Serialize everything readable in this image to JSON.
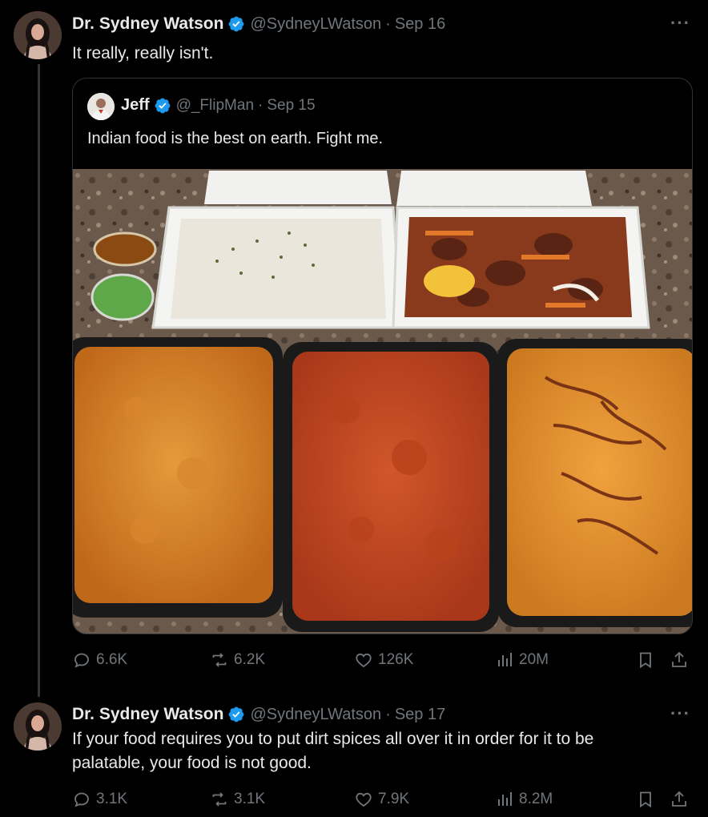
{
  "thread": [
    {
      "author": {
        "name": "Dr. Sydney Watson",
        "handle": "@SydneyLWatson",
        "date": "Sep 16",
        "avatar_icon": "profile-photo"
      },
      "text": "It really, really isn't.",
      "more_label": "···",
      "quoted": {
        "author": {
          "name": "Jeff",
          "handle": "@_FlipMan",
          "date": "Sep 15"
        },
        "text": "Indian food is the best on earth. Fight me.",
        "image_description": "Indian takeout: rice, chicken, three curries"
      },
      "stats": {
        "replies": "6.6K",
        "reposts": "6.2K",
        "likes": "126K",
        "views": "20M"
      }
    },
    {
      "author": {
        "name": "Dr. Sydney Watson",
        "handle": "@SydneyLWatson",
        "date": "Sep 17",
        "avatar_icon": "profile-photo"
      },
      "text_line1": "If your food requires you to put dirt spices all over it in order for it to be",
      "text_line2": "palatable, your food is not good.",
      "more_label": "···",
      "stats": {
        "replies": "3.1K",
        "reposts": "3.1K",
        "likes": "7.9K",
        "views": "8.2M"
      }
    }
  ],
  "colors": {
    "background": "#000000",
    "text_primary": "#e7e9ea",
    "text_secondary": "#71767b",
    "verified_blue": "#1d9bf0",
    "border": "#2f3336"
  }
}
